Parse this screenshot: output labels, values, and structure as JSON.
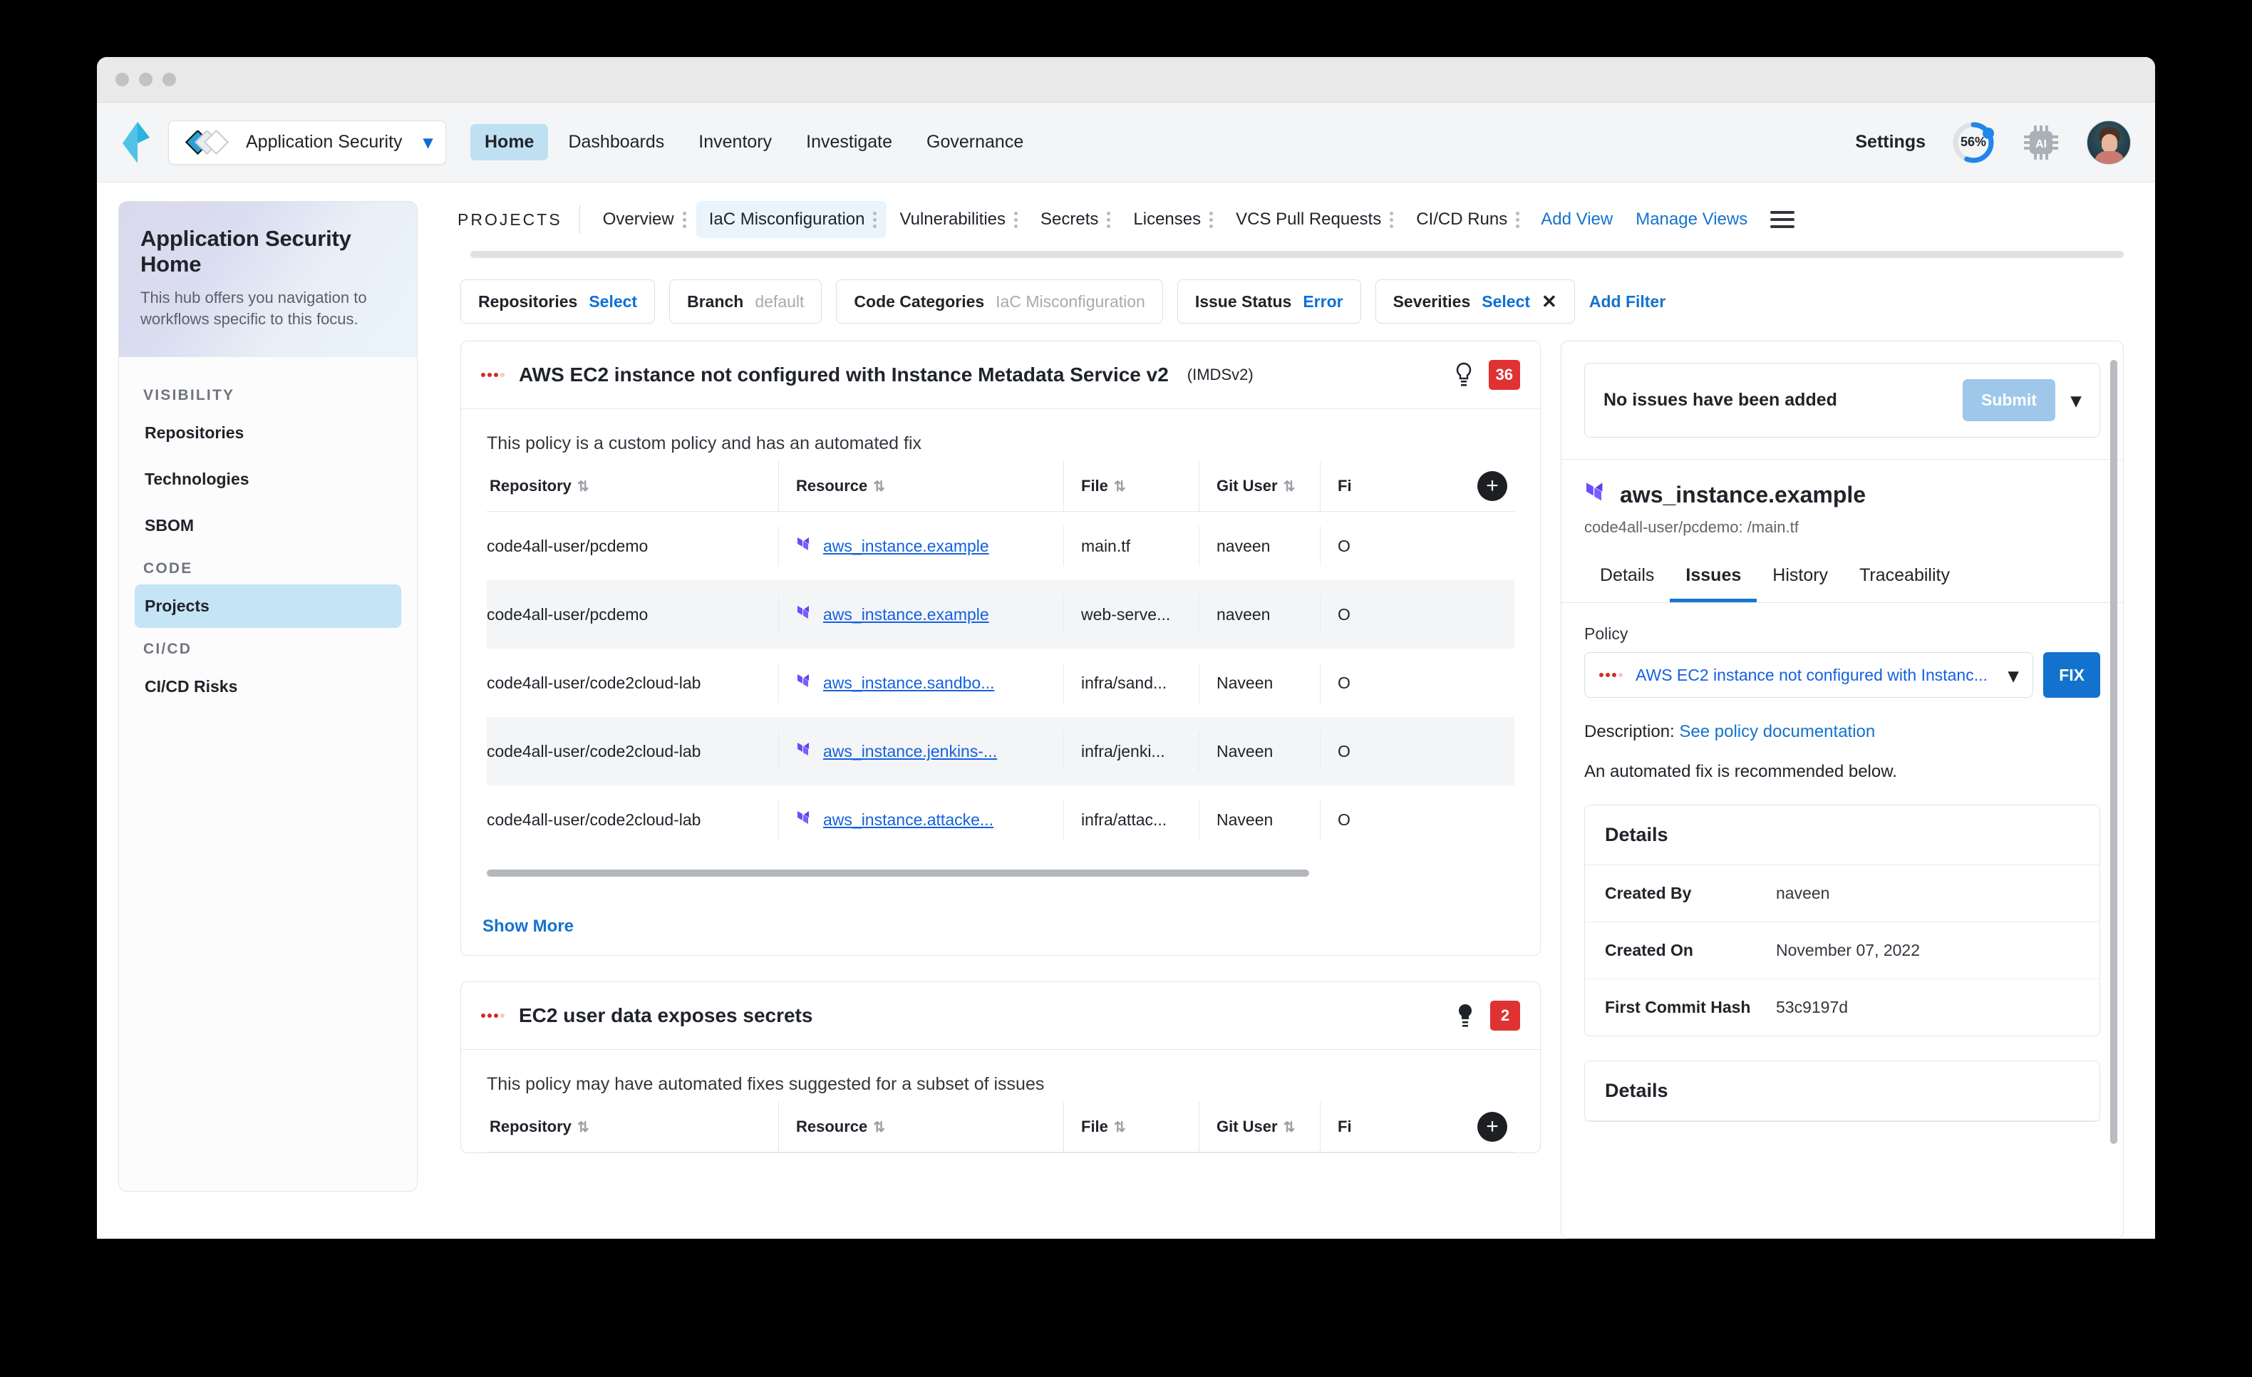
{
  "header": {
    "focus_label": "Application Security",
    "nav": [
      {
        "label": "Home",
        "active": true
      },
      {
        "label": "Dashboards",
        "active": false
      },
      {
        "label": "Inventory",
        "active": false
      },
      {
        "label": "Investigate",
        "active": false
      },
      {
        "label": "Governance",
        "active": false
      }
    ],
    "settings_label": "Settings",
    "progress_pct": "56%",
    "progress_value": 56
  },
  "sidebar": {
    "title": "Application Security Home",
    "subtitle": "This hub offers you navigation to workflows specific to this focus.",
    "groups": [
      {
        "label": "VISIBILITY",
        "items": [
          {
            "label": "Repositories",
            "active": false
          },
          {
            "label": "Technologies",
            "active": false
          },
          {
            "label": "SBOM",
            "active": false
          }
        ]
      },
      {
        "label": "CODE",
        "items": [
          {
            "label": "Projects",
            "active": true
          }
        ]
      },
      {
        "label": "CI/CD",
        "items": [
          {
            "label": "CI/CD Risks",
            "active": false
          }
        ]
      }
    ]
  },
  "views": {
    "section_label": "PROJECTS",
    "tabs": [
      {
        "label": "Overview",
        "active": false
      },
      {
        "label": "IaC Misconfiguration",
        "active": true
      },
      {
        "label": "Vulnerabilities",
        "active": false
      },
      {
        "label": "Secrets",
        "active": false
      },
      {
        "label": "Licenses",
        "active": false
      },
      {
        "label": "VCS Pull Requests",
        "active": false
      },
      {
        "label": "CI/CD Runs",
        "active": false
      }
    ],
    "add_view": "Add View",
    "manage_views": "Manage Views"
  },
  "filters": {
    "items": [
      {
        "key": "Repositories",
        "value": "Select",
        "value_style": "link",
        "removable": false
      },
      {
        "key": "Branch",
        "value": "default",
        "value_style": "muted",
        "removable": false
      },
      {
        "key": "Code Categories",
        "value": "IaC Misconfiguration",
        "value_style": "muted",
        "removable": false
      },
      {
        "key": "Issue Status",
        "value": "Error",
        "value_style": "link",
        "removable": false
      },
      {
        "key": "Severities",
        "value": "Select",
        "value_style": "link",
        "removable": true
      }
    ],
    "add_filter": "Add Filter"
  },
  "policy_cards": [
    {
      "title": "AWS EC2 instance not configured with Instance Metadata Service v2",
      "subtitle": "(IMDSv2)",
      "count": "36",
      "note": "This policy is a custom policy and has an automated fix",
      "columns": [
        "Repository",
        "Resource",
        "File",
        "Git User",
        "Fi"
      ],
      "rows": [
        {
          "repository": "code4all-user/pcdemo",
          "resource": "aws_instance.example",
          "file": "main.tf",
          "git_user": "naveen",
          "extra": "O"
        },
        {
          "repository": "code4all-user/pcdemo",
          "resource": "aws_instance.example",
          "file": "web-serve...",
          "git_user": "naveen",
          "extra": "O"
        },
        {
          "repository": "code4all-user/code2cloud-lab",
          "resource": "aws_instance.sandbo...",
          "file": "infra/sand...",
          "git_user": "Naveen",
          "extra": "O"
        },
        {
          "repository": "code4all-user/code2cloud-lab",
          "resource": "aws_instance.jenkins-...",
          "file": "infra/jenki...",
          "git_user": "Naveen",
          "extra": "O"
        },
        {
          "repository": "code4all-user/code2cloud-lab",
          "resource": "aws_instance.attacke...",
          "file": "infra/attac...",
          "git_user": "Naveen",
          "extra": "O"
        }
      ],
      "show_more": "Show More"
    },
    {
      "title": "EC2 user data exposes secrets",
      "subtitle": "",
      "count": "2",
      "note": "This policy may have automated fixes suggested for a subset of issues",
      "columns": [
        "Repository",
        "Resource",
        "File",
        "Git User",
        "Fi"
      ],
      "rows": [],
      "show_more": ""
    }
  ],
  "details_panel": {
    "issue_bar_text": "No issues have been added",
    "submit_label": "Submit",
    "resource_name": "aws_instance.example",
    "resource_path": "code4all-user/pcdemo: /main.tf",
    "tabs": [
      {
        "label": "Details",
        "active": false
      },
      {
        "label": "Issues",
        "active": true
      },
      {
        "label": "History",
        "active": false
      },
      {
        "label": "Traceability",
        "active": false
      }
    ],
    "policy_field_label": "Policy",
    "policy_value": "AWS EC2 instance not configured with Instanc...",
    "fix_label": "FIX",
    "description_label": "Description:",
    "description_link": "See policy documentation",
    "automated_fix_text": "An automated fix is recommended below.",
    "details_card": {
      "title": "Details",
      "rows": [
        {
          "key": "Created By",
          "value": "naveen"
        },
        {
          "key": "Created On",
          "value": "November 07, 2022"
        },
        {
          "key": "First Commit Hash",
          "value": "53c9197d"
        }
      ]
    },
    "second_details_title": "Details"
  },
  "colors": {
    "accent_blue": "#1473cc",
    "link_blue": "#1461e0",
    "severity_red": "#e03232",
    "active_tab_bg": "#bfe0f3",
    "terraform_purple": "#5c4ee5"
  }
}
